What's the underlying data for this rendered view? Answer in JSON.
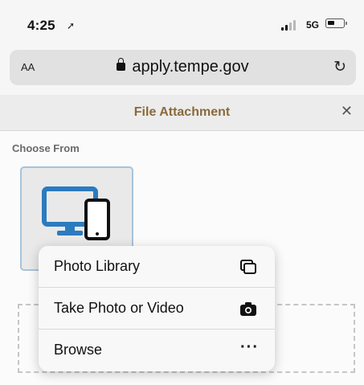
{
  "status_bar": {
    "time": "4:25",
    "location_icon": "location-arrow-icon",
    "network": "5G"
  },
  "address_bar": {
    "text_size_label": "AA",
    "url": "apply.tempe.gov",
    "lock_icon": "lock-icon",
    "reload_icon": "reload-icon"
  },
  "modal": {
    "title": "File Attachment",
    "close_icon": "close-icon"
  },
  "content": {
    "choose_from_label": "Choose From",
    "source_icon": "desktop-and-phone-icon"
  },
  "menu": {
    "items": [
      {
        "label": "Photo Library",
        "icon": "photo-library-icon"
      },
      {
        "label": "Take Photo or Video",
        "icon": "camera-icon"
      },
      {
        "label": "Browse",
        "icon": "more-dots-icon"
      }
    ]
  },
  "colors": {
    "title_accent": "#8a6a3c",
    "icon_blue": "#2b7bbf",
    "tile_border": "#a7c3dc"
  }
}
